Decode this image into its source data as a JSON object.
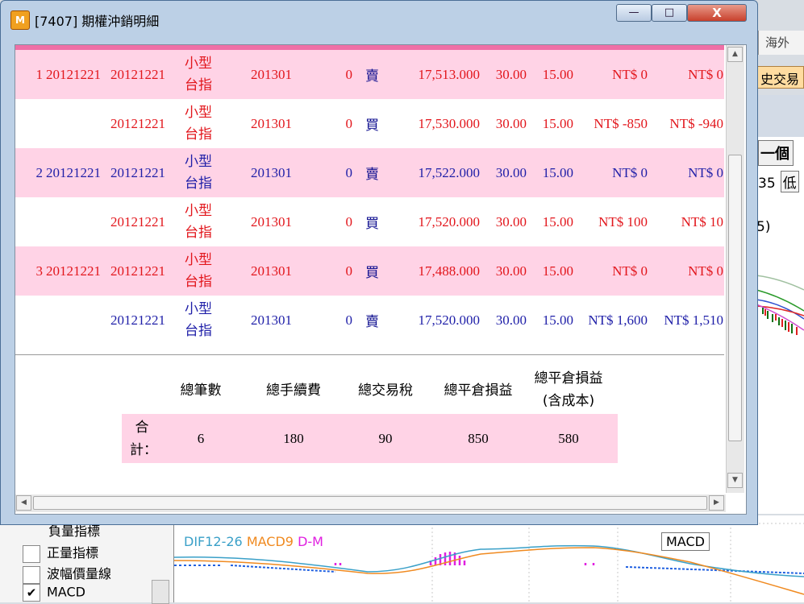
{
  "window": {
    "icon_text": "M",
    "title": "[7407] 期權沖銷明細",
    "minimize": "—",
    "maximize": "□",
    "close": "X"
  },
  "rows": [
    {
      "no": "1",
      "date1": "20121221",
      "date2": "20121221",
      "product_line1": "小型",
      "product_line2": "台指",
      "month": "201301",
      "qty": "0",
      "side": "賣",
      "price": "17,513.000",
      "fee": "30.00",
      "tax": "15.00",
      "pl": "NT$ 0",
      "pl_cost": "NT$ 0",
      "color": "red",
      "bg": "pink"
    },
    {
      "no": "",
      "date1": "",
      "date2": "20121221",
      "product_line1": "小型",
      "product_line2": "台指",
      "month": "201301",
      "qty": "0",
      "side": "買",
      "price": "17,530.000",
      "fee": "30.00",
      "tax": "15.00",
      "pl": "NT$ -850",
      "pl_cost": "NT$ -940",
      "color": "red",
      "bg": "white"
    },
    {
      "no": "2",
      "date1": "20121221",
      "date2": "20121221",
      "product_line1": "小型",
      "product_line2": "台指",
      "month": "201301",
      "qty": "0",
      "side": "賣",
      "price": "17,522.000",
      "fee": "30.00",
      "tax": "15.00",
      "pl": "NT$ 0",
      "pl_cost": "NT$ 0",
      "color": "blue",
      "bg": "pink"
    },
    {
      "no": "",
      "date1": "",
      "date2": "20121221",
      "product_line1": "小型",
      "product_line2": "台指",
      "month": "201301",
      "qty": "0",
      "side": "買",
      "price": "17,520.000",
      "fee": "30.00",
      "tax": "15.00",
      "pl": "NT$ 100",
      "pl_cost": "NT$ 10",
      "color": "red",
      "bg": "white"
    },
    {
      "no": "3",
      "date1": "20121221",
      "date2": "20121221",
      "product_line1": "小型",
      "product_line2": "台指",
      "month": "201301",
      "qty": "0",
      "side": "買",
      "price": "17,488.000",
      "fee": "30.00",
      "tax": "15.00",
      "pl": "NT$ 0",
      "pl_cost": "NT$ 0",
      "color": "red",
      "bg": "pink"
    },
    {
      "no": "",
      "date1": "",
      "date2": "20121221",
      "product_line1": "小型",
      "product_line2": "台指",
      "month": "201301",
      "qty": "0",
      "side": "賣",
      "price": "17,520.000",
      "fee": "30.00",
      "tax": "15.00",
      "pl": "NT$ 1,600",
      "pl_cost": "NT$ 1,510",
      "color": "blue",
      "bg": "white"
    }
  ],
  "summary": {
    "headers": {
      "count": "總筆數",
      "fee": "總手續費",
      "tax": "總交易稅",
      "pl": "總平倉損益",
      "pl_cost_line1": "總平倉損益",
      "pl_cost_line2": "(含成本)"
    },
    "label_line1": "合",
    "label_line2": "計：",
    "values": {
      "count": "6",
      "fee": "180",
      "tax": "90",
      "pl": "850",
      "pl_cost": "580"
    }
  },
  "background": {
    "tab_label": "海外",
    "history_button": "史交易",
    "next_button": "一個",
    "low_prefix": "35",
    "low_label": "低",
    "paren_text": "5)",
    "indicator_list": [
      {
        "label": "負量指標",
        "checked": false
      },
      {
        "label": "正量指標",
        "checked": false
      },
      {
        "label": "波幅價量線",
        "checked": false
      },
      {
        "label": "MACD",
        "checked": true
      }
    ],
    "check_mark": "✔",
    "macd_legend": {
      "dif": "DIF12-26",
      "macd": "MACD9",
      "dm": "D-M"
    },
    "macd_box": "MACD"
  },
  "colors": {
    "row_pink": "#ffd3e6",
    "red_text": "#e2161c",
    "blue_text": "#1f1fa8",
    "accent_bar": "#ef6fa6",
    "macd_dif": "#3aa0c8",
    "macd_line": "#f08a20",
    "macd_dm": "#e020e0"
  }
}
